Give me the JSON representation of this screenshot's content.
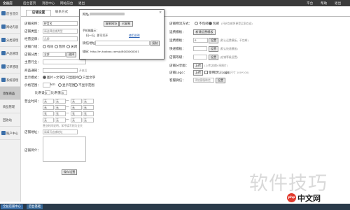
{
  "topbar": {
    "brand": "全益店",
    "links": [
      "后台首页",
      "消息中心",
      "网站前台",
      "退出"
    ],
    "right": [
      "平台",
      "帮助",
      "退出"
    ]
  },
  "sidebar": {
    "items": [
      {
        "label": "后台首页"
      },
      {
        "label": "网站内容"
      },
      {
        "label": "分类管理"
      },
      {
        "label": "产品管理"
      },
      {
        "label": "订单管理"
      },
      {
        "label": "系统管理"
      },
      {
        "label": "添加商品"
      },
      {
        "label": "商品管理"
      },
      {
        "label": "回收站"
      },
      {
        "label": "账户中心"
      }
    ]
  },
  "tabs": {
    "active": "店铺设置",
    "second": "联系方式"
  },
  "form_left": {
    "name_label": "店铺名称：",
    "name_value": "拼音名",
    "type_label": "店铺类型：",
    "type_placeholder": "请选择店铺类型",
    "brand_label": "经营品牌：",
    "brand_placeholder": "品牌",
    "shop_label": "店铺介绍：",
    "shop_radio": [
      "有效",
      "暂停",
      "关闭"
    ],
    "seller_label": "店铺分类：",
    "seller_value": "全部",
    "seller_btn": "选择",
    "industry_label": "主营行业：",
    "notice_label": "商品通知：",
    "notice_value": "",
    "notice_hint": "开启后",
    "show_label": "显示模式：",
    "show_opts": [
      "图片+文字",
      "只显图片",
      "只显文字"
    ],
    "price_label": "价格范围：",
    "price_unit": "km",
    "price_opts": [
      "显示范围",
      "不显示范围"
    ],
    "ratio_label": "比例设置：",
    "ratio_values": [
      "0",
      "0"
    ],
    "ratio_text": "比例值：",
    "time_label": "营业时间：",
    "time_rows": [
      [
        "无",
        "无",
        "—",
        "无",
        "无"
      ],
      [
        "无",
        "无",
        "—",
        "无",
        "无"
      ],
      [
        "无",
        "无",
        "—",
        "无",
        "无"
      ],
      [
        "无",
        "无",
        "—",
        "无",
        "无"
      ]
    ],
    "time_hint": "营业时间说明，如不填写则为全天",
    "addr_label": "店铺地址：",
    "addr_placeholder": "请填写店铺地址",
    "desc_label": "店铺简介：",
    "save_button": "保存设置"
  },
  "popup": {
    "title_label": "提示：",
    "row1_label": "网址：",
    "row1_btn": "复制网址",
    "row1_btn2": "已复制",
    "row2_label": "手机端展示：",
    "row2_text": "扫一扫，即可打开",
    "row2_link": "使用说明",
    "row3_label": "微信地址：",
    "row3_btn": "复制",
    "row4_label": "链接：",
    "row4_url": "http://m.taobao.com/p/8000000001"
  },
  "form_right": {
    "r1_label": "店铺物流方式：",
    "r1_opts": [
      "不包邮",
      "包邮"
    ],
    "r1_hint": "(开启包邮将更受买家欢迎)",
    "r2_label": "运费模板：",
    "r2_btn": "新建运费模板",
    "r3_label": "运费模板：",
    "r3_value": "0",
    "r3_btn": "设置",
    "r3_hint": "(默认运费模板，不包邮)",
    "r4_label": "快递模板：",
    "r4_btn": "设置",
    "r4_hint": "(默认快递模板)",
    "r5_label": "店铺等级：",
    "r5_btn": "设置",
    "r5_hint": "(店铺等级设置)",
    "r6_label": "店铺分享图：",
    "r6_btn": "上传",
    "r6_hint": "(上传店铺分享图片)",
    "r7_label": "店铺Logo：",
    "r7_btn": "上传",
    "r7_check": "使用默认Logo",
    "r7_hint": "(建议尺寸 100*100)",
    "r8_label": "客服微信：",
    "r8_value": "添加客服微信",
    "r8_btn": "设置"
  },
  "bottombar": {
    "left": "全益店铺中心",
    "right": "后台基础"
  },
  "watermark": "软件技巧",
  "badge": {
    "php": "php",
    "site": "中文网"
  },
  "colors": {
    "accent": "#3b6fa8",
    "topbar": "#3a3a3a",
    "bottombar": "#2a3a4a"
  }
}
